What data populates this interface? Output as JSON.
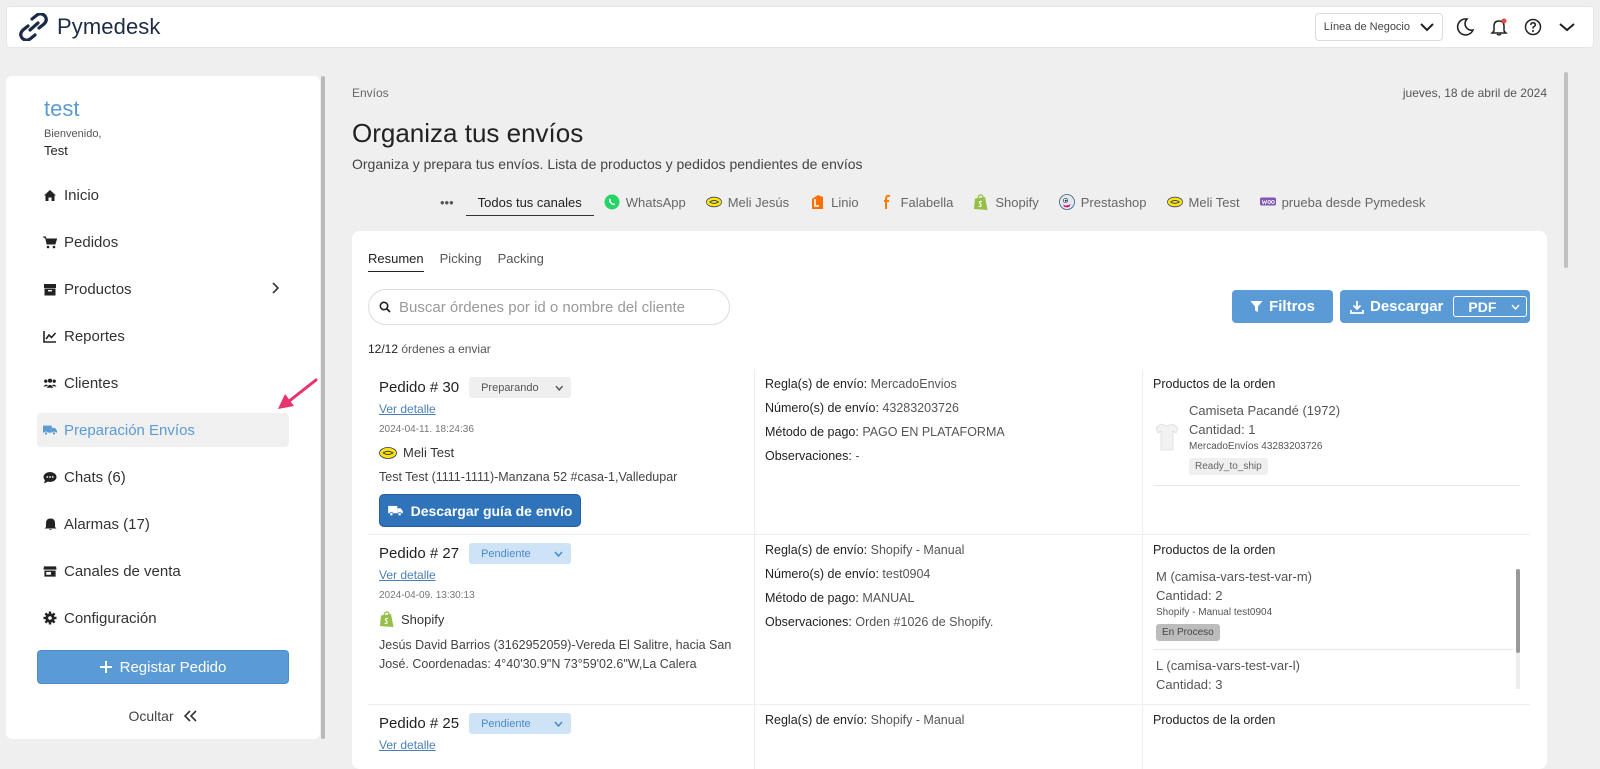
{
  "app": {
    "name": "Pymedesk"
  },
  "topbar": {
    "business_line": "Línea de Negocio"
  },
  "sidebar": {
    "user_name": "test",
    "welcome": "Bienvenido,",
    "user_display": "Test",
    "items": [
      {
        "label": "Inicio",
        "icon": "home-icon"
      },
      {
        "label": "Pedidos",
        "icon": "cart-icon"
      },
      {
        "label": "Productos",
        "icon": "box-icon"
      },
      {
        "label": "Reportes",
        "icon": "chart-icon"
      },
      {
        "label": "Clientes",
        "icon": "users-icon"
      },
      {
        "label": "Preparación Envíos",
        "icon": "truck-icon"
      },
      {
        "label": "Chats (6)",
        "icon": "chat-icon"
      },
      {
        "label": "Alarmas (17)",
        "icon": "bell-icon"
      },
      {
        "label": "Canales de venta",
        "icon": "store-icon"
      },
      {
        "label": "Configuración",
        "icon": "gear-icon"
      }
    ],
    "register_button": "Registar Pedido",
    "hide": "Ocultar"
  },
  "main": {
    "breadcrumb": "Envíos",
    "date": "jueves, 18 de abril de 2024",
    "title": "Organiza tus envíos",
    "subtitle": "Organiza y prepara tus envíos. Lista de productos y pedidos pendientes de envíos",
    "channels": [
      "Todos tus canales",
      "WhatsApp",
      "Meli Jesús",
      "Linio",
      "Falabella",
      "Shopify",
      "Prestashop",
      "Meli Test",
      "prueba desde Pymedesk"
    ],
    "tabs": [
      "Resumen",
      "Picking",
      "Packing"
    ],
    "search_placeholder": "Buscar órdenes por id o nombre del cliente",
    "filters_button": "Filtros",
    "download_button": "Descargar",
    "download_format": "PDF",
    "count_bold": "12/12",
    "count_text": "órdenes a enviar"
  },
  "labels": {
    "view_detail": "Ver detalle",
    "rule": "Regla(s) de envío:",
    "tracking": "Número(s) de envío:",
    "payment": "Método de pago:",
    "notes": "Observaciones:",
    "products_header": "Productos de la orden",
    "guide_button": "Descargar guía de envío"
  },
  "orders": [
    {
      "title": "Pedido # 30",
      "status": "Preparando",
      "date": "2024-04-11. 18:24:36",
      "channel": "Meli Test",
      "address": "Test Test (1111-1111)-Manzana 52 #casa-1,Valledupar",
      "rule": "MercadoEnvios",
      "tracking": "43283203726",
      "payment": "PAGO EN PLATAFORMA",
      "notes": "-",
      "products": [
        {
          "name": "Camiseta Pacandé (1972)",
          "qty": "Cantidad: 1",
          "meta": "MercadoEnvíos 43283203726",
          "badge": "Ready_to_ship"
        }
      ]
    },
    {
      "title": "Pedido # 27",
      "status": "Pendiente",
      "date": "2024-04-09. 13:30:13",
      "channel": "Shopify",
      "address": "Jesús David Barrios (3162952059)-Vereda El Salitre, hacia San José. Coordenadas: 4°40'30.9\"N 73°59'02.6\"W,La Calera",
      "rule": "Shopify - Manual",
      "tracking": "test0904",
      "payment": "MANUAL",
      "notes": "Orden #1026 de Shopify.",
      "products": [
        {
          "name": "M (camisa-vars-test-var-m)",
          "qty": "Cantidad: 2",
          "meta": "Shopify - Manual test0904",
          "badge": "En Proceso"
        },
        {
          "name": "L (camisa-vars-test-var-l)",
          "qty": "Cantidad: 3"
        }
      ]
    },
    {
      "title": "Pedido # 25",
      "status": "Pendiente",
      "rule": "Shopify - Manual"
    }
  ],
  "colors": {
    "accent": "#5b9bd5",
    "guide_button": "#2f73bb",
    "arrow": "#e8336b"
  }
}
